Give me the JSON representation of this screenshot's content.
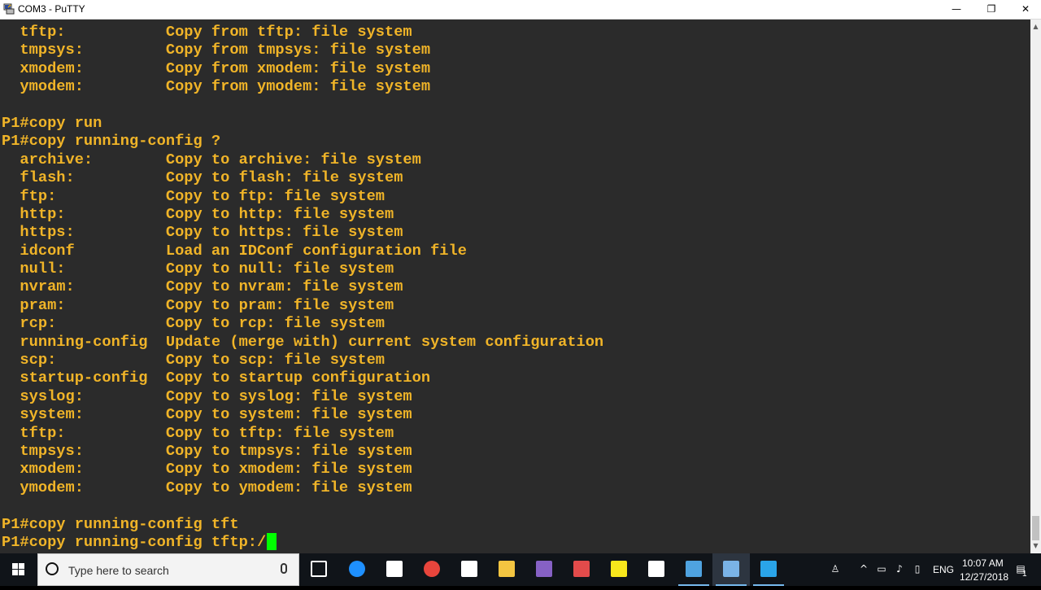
{
  "window": {
    "title": "COM3 - PuTTY",
    "minimize": "—",
    "restore": "❐",
    "close": "✕"
  },
  "terminal": {
    "lines": [
      "  tftp:           Copy from tftp: file system",
      "  tmpsys:         Copy from tmpsys: file system",
      "  xmodem:         Copy from xmodem: file system",
      "  ymodem:         Copy from ymodem: file system",
      "",
      "P1#copy run",
      "P1#copy running-config ?",
      "  archive:        Copy to archive: file system",
      "  flash:          Copy to flash: file system",
      "  ftp:            Copy to ftp: file system",
      "  http:           Copy to http: file system",
      "  https:          Copy to https: file system",
      "  idconf          Load an IDConf configuration file",
      "  null:           Copy to null: file system",
      "  nvram:          Copy to nvram: file system",
      "  pram:           Copy to pram: file system",
      "  rcp:            Copy to rcp: file system",
      "  running-config  Update (merge with) current system configuration",
      "  scp:            Copy to scp: file system",
      "  startup-config  Copy to startup configuration",
      "  syslog:         Copy to syslog: file system",
      "  system:         Copy to system: file system",
      "  tftp:           Copy to tftp: file system",
      "  tmpsys:         Copy to tmpsys: file system",
      "  xmodem:         Copy to xmodem: file system",
      "  ymodem:         Copy to ymodem: file system",
      "",
      "P1#copy running-config tft"
    ],
    "prompt_line": "P1#copy running-config tftp:/",
    "text_color": "#f0b428",
    "background": "#2b2b2b",
    "cursor_color": "#00ff00"
  },
  "taskbar": {
    "search_placeholder": "Type here to search",
    "apps": [
      {
        "name": "task-view-icon",
        "color": "#ffffff"
      },
      {
        "name": "edge-icon",
        "color": "#1e90ff"
      },
      {
        "name": "store-icon",
        "color": "#ffffff"
      },
      {
        "name": "chrome-icon",
        "color": "#e8453c"
      },
      {
        "name": "calculator-icon",
        "color": "#ffffff"
      },
      {
        "name": "file-explorer-icon",
        "color": "#f3c541"
      },
      {
        "name": "visual-studio-icon",
        "color": "#8661c5"
      },
      {
        "name": "snipping-tool-icon",
        "color": "#e24b4b"
      },
      {
        "name": "sticky-notes-icon",
        "color": "#f8e71c"
      },
      {
        "name": "mail-icon",
        "color": "#ffffff"
      },
      {
        "name": "network-app-icon",
        "color": "#4fa3e0"
      },
      {
        "name": "putty-icon",
        "color": "#7ab3e6"
      },
      {
        "name": "remote-desktop-icon",
        "color": "#2aa4e8"
      }
    ],
    "language": "ENG",
    "time": "10:07 AM",
    "date": "12/27/2018",
    "notification_count": "1"
  }
}
